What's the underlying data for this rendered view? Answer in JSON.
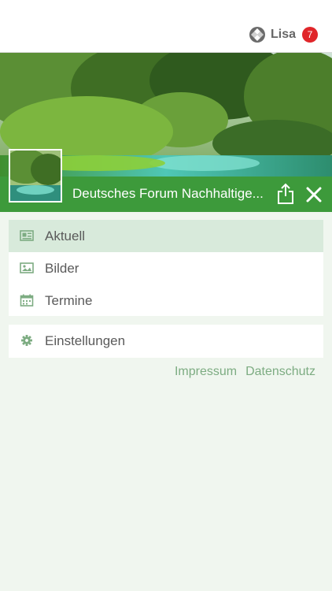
{
  "header": {
    "user_name": "Lisa",
    "notification_count": "7",
    "badge_color": "#e0262a"
  },
  "group": {
    "title": "Deutsches Forum Nachhaltige...",
    "accent_color": "#3d9a3b"
  },
  "menu_main": [
    {
      "label": "Aktuell",
      "icon": "newspaper-icon",
      "active": true
    },
    {
      "label": "Bilder",
      "icon": "image-icon",
      "active": false
    },
    {
      "label": "Termine",
      "icon": "calendar-icon",
      "active": false
    }
  ],
  "menu_settings": [
    {
      "label": "Einstellungen",
      "icon": "gear-icon"
    }
  ],
  "footer_links": {
    "impressum": "Impressum",
    "datenschutz": "Datenschutz"
  }
}
